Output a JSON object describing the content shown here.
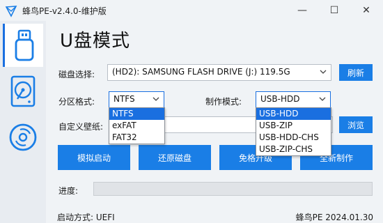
{
  "window": {
    "title": "蜂鸟PE-v2.4.0-维护版"
  },
  "titlebar": {
    "minimize": "—",
    "maximize": "☐",
    "close": "✕"
  },
  "sidebar": {
    "items": [
      {
        "name": "usb-mode",
        "icon": "usb-drive-icon",
        "active": true
      },
      {
        "name": "disk-mode",
        "icon": "hard-disk-icon",
        "active": false
      },
      {
        "name": "iso-mode",
        "icon": "cd-icon",
        "active": false
      }
    ]
  },
  "main": {
    "heading": "U盘模式",
    "disk_label": "磁盘选择:",
    "disk_value": "(HD2): SAMSUNG FLASH DRIVE (J:) 119.5G",
    "refresh": "刷新",
    "partition_label": "分区格式:",
    "partition_value": "NTFS",
    "partition_options": [
      "NTFS",
      "exFAT",
      "FAT32"
    ],
    "mode_label": "制作模式:",
    "mode_value": "USB-HDD",
    "mode_options": [
      "USB-HDD",
      "USB-ZIP",
      "USB-HDD-CHS",
      "USB-ZIP-CHS"
    ],
    "wallpaper_label": "自定义壁纸:",
    "browse": "浏览",
    "actions": {
      "simulate": "模拟启动",
      "restore": "还原磁盘",
      "upgrade": "免格升级",
      "make": "全新制作"
    },
    "progress_label": "进度:",
    "progress_value": 0
  },
  "footer": {
    "boot_mode": "启动方式: UEFI",
    "version": "蜂鸟PE 2024.01.30"
  },
  "colors": {
    "accent": "#1a7ee6",
    "selection": "#1a6fe0"
  }
}
